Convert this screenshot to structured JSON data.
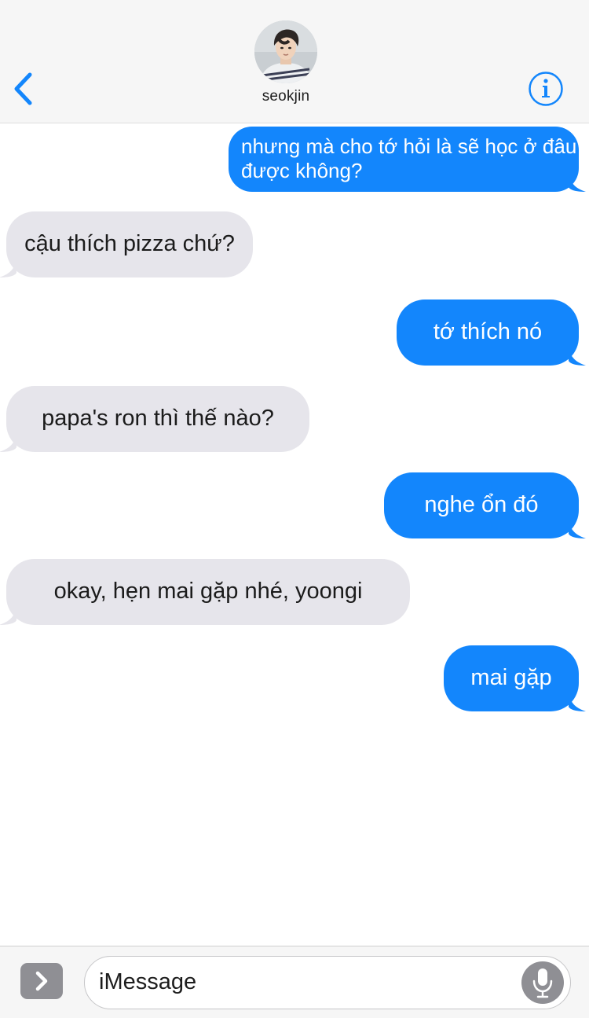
{
  "header": {
    "contact_name": "seokjin",
    "back_icon": "chevron-left-icon",
    "info_icon": "info-icon",
    "accent_color": "#1386fc"
  },
  "messages": [
    {
      "direction": "outgoing",
      "text": "nhưng mà cho tớ hỏi là sẽ học ở đâu được không?"
    },
    {
      "direction": "incoming",
      "text": "cậu thích pizza chứ?"
    },
    {
      "direction": "outgoing",
      "text": "tớ thích nó"
    },
    {
      "direction": "incoming",
      "text": "papa's ron thì thế nào?"
    },
    {
      "direction": "outgoing",
      "text": "nghe ổn đó"
    },
    {
      "direction": "incoming",
      "text": "okay, hẹn mai gặp nhé, yoongi"
    },
    {
      "direction": "outgoing",
      "text": "mai gặp"
    }
  ],
  "input_bar": {
    "placeholder": "iMessage",
    "apps_icon": "chevron-right-icon",
    "mic_icon": "microphone-icon"
  },
  "colors": {
    "outgoing_bubble": "#1386fc",
    "incoming_bubble": "#e6e5eb",
    "header_bg": "#f6f6f6"
  }
}
